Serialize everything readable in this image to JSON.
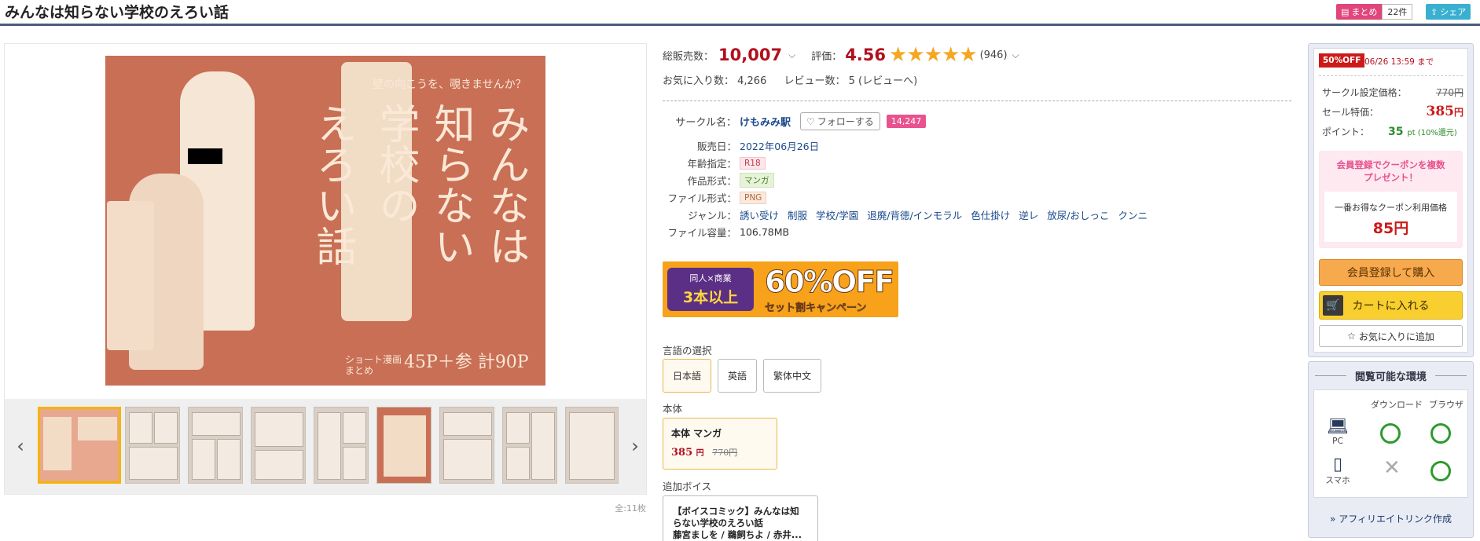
{
  "header": {
    "title": "みんなは知らない学校のえろい話",
    "matome_label": "まとめ",
    "matome_count": "22件",
    "share_label": "シェア"
  },
  "cover": {
    "tagline": "壁の向こうを、覗きませんか？",
    "title_col1": "みんなは",
    "title_col2": "知らない",
    "title_col3": "学校の",
    "title_col4": "えろい話",
    "bottom_small": "ショート漫画\nまとめ",
    "bottom_pages": "45P＋参",
    "bottom_total": "計90P"
  },
  "gallery": {
    "prev_arrow": "‹",
    "next_arrow": "›",
    "page_count": "全:11枚"
  },
  "stats": {
    "sold_label": "総販売数：",
    "sold_value": "10,007",
    "rating_label": "評価：",
    "rating_value": "4.56",
    "stars": "★★★★★",
    "rating_count": "(946)",
    "fav_line": "お気に入り数： 4,266",
    "review_line": "レビュー数： 5 (レビューへ)"
  },
  "specs": {
    "circle_label": "サークル名：",
    "circle_name": "けもみみ駅",
    "follow_label": "フォローする",
    "follow_count": "14,247",
    "date_label": "販売日：",
    "date_value": "2022年06月26日",
    "age_label": "年齢指定：",
    "age_value": "R18",
    "format_label": "作品形式：",
    "format_value": "マンガ",
    "file_label": "ファイル形式：",
    "file_value": "PNG",
    "genre_label": "ジャンル：",
    "genres": [
      "誘い受け",
      "制服",
      "学校/学園",
      "退廃/背徳/インモラル",
      "色仕掛け",
      "逆レ",
      "放尿/おしっこ",
      "クンニ"
    ],
    "size_label": "ファイル容量：",
    "size_value": "106.78MB"
  },
  "banner": {
    "line1": "同人×商業",
    "line2": "3本以上",
    "pct": "60%OFF",
    "sub": "セット割キャンペーン"
  },
  "language": {
    "label": "言語の選択",
    "options": [
      "日本語",
      "英語",
      "繁体中文"
    ]
  },
  "edition": {
    "label": "本体",
    "name": "本体 マンガ",
    "price": "385",
    "price_unit": "円",
    "orig_price": "770円"
  },
  "voice": {
    "label": "追加ボイス",
    "title": "【ボイスコミック】みんなは知らない学校のえろい話",
    "cast": "藤宮ましを / 鵜飼ちよ / 赤井..."
  },
  "buy": {
    "off_badge": "50%OFF",
    "off_until": "06/26 13:59 まで",
    "set_price_label": "サークル設定価格：",
    "set_price": "770円",
    "sale_label": "セール特価：",
    "sale_price": "385",
    "sale_unit": "円",
    "point_label": "ポイント：",
    "point_value": "35",
    "point_unit": "pt (10%還元)",
    "coupon_msg": "会員登録でクーポンを複数\nプレゼント！",
    "coupon_label": "一番お得なクーポン利用価格",
    "coupon_price": "85円",
    "member_btn": "会員登録して購入",
    "cart_btn": "カートに入れる",
    "fav_btn": "お気に入りに追加"
  },
  "env": {
    "title": "閲覧可能な環境",
    "col_download": "ダウンロード",
    "col_browser": "ブラウザ",
    "pc_label": "PC",
    "phone_label": "スマホ",
    "affiliate": "» アフィリエイトリンク作成"
  }
}
